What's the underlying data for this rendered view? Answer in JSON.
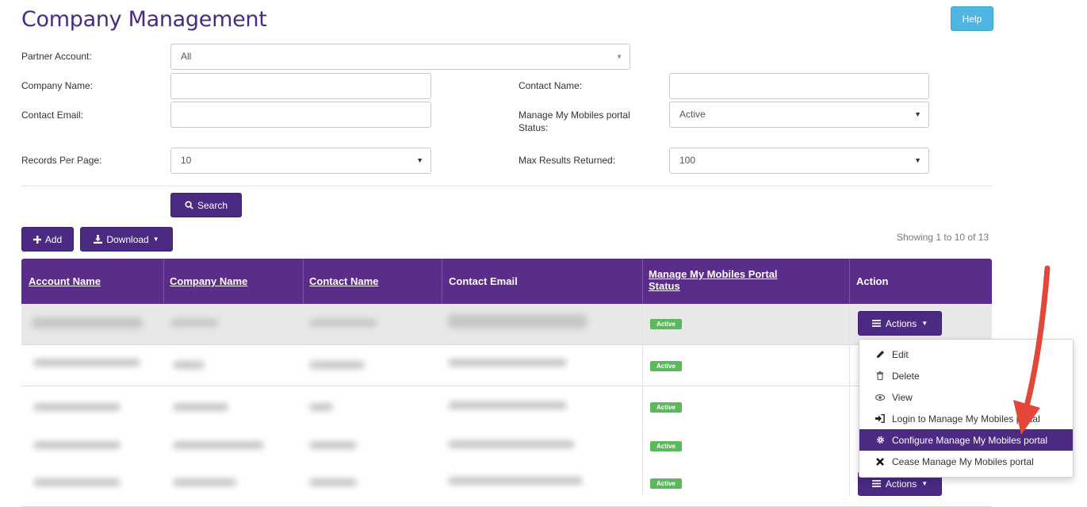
{
  "page": {
    "title": "Company Management",
    "help_label": "Help"
  },
  "filters": {
    "partner_account": {
      "label": "Partner Account:",
      "value": "All"
    },
    "company_name": {
      "label": "Company Name:",
      "value": ""
    },
    "contact_name": {
      "label": "Contact Name:",
      "value": ""
    },
    "contact_email": {
      "label": "Contact Email:",
      "value": ""
    },
    "portal_status": {
      "label_line1": "Manage My Mobiles portal",
      "label_line2": "Status:",
      "value": "Active"
    },
    "records_per_page": {
      "label": "Records Per Page:",
      "value": "10"
    },
    "max_results": {
      "label": "Max Results Returned:",
      "value": "100"
    },
    "search_label": "Search"
  },
  "toolbar": {
    "add_label": "Add",
    "download_label": "Download",
    "showing": "Showing 1 to 10 of 13"
  },
  "table": {
    "headers": {
      "account_name": "Account Name",
      "company_name": "Company Name",
      "contact_name": "Contact Name",
      "contact_email": "Contact Email",
      "portal_status_line1": "Manage My Mobiles Portal",
      "portal_status_line2": "Status",
      "action": "Action"
    },
    "rows": [
      {
        "status": "Active",
        "actions_label": "Actions"
      },
      {
        "status": "Active"
      },
      {
        "status": "Active"
      },
      {
        "status": "Active"
      },
      {
        "status": "Active",
        "actions_label": "Actions"
      }
    ]
  },
  "actions_menu": {
    "items": [
      {
        "label": "Edit",
        "icon": "pencil-icon"
      },
      {
        "label": "Delete",
        "icon": "trash-icon"
      },
      {
        "label": "View",
        "icon": "eye-icon"
      },
      {
        "label": "Login to Manage My Mobiles portal",
        "icon": "login-icon"
      },
      {
        "label": "Configure Manage My Mobiles portal",
        "icon": "cog-icon",
        "highlighted": true
      },
      {
        "label": "Cease Manage My Mobiles portal",
        "icon": "close-icon"
      }
    ]
  },
  "colors": {
    "brand": "#4b2a84",
    "header": "#5b2d8a",
    "help": "#4fb6e3",
    "badge": "#5cb85c",
    "arrow": "#e2473a"
  }
}
